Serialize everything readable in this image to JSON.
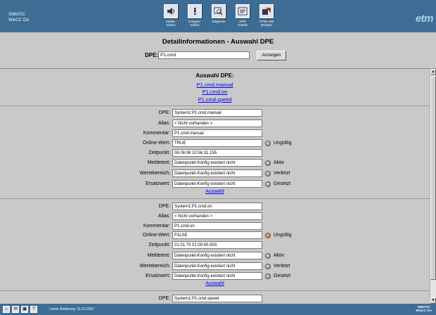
{
  "brand": {
    "line1": "SIMATIC",
    "line2": "WinCC OA"
  },
  "nav": [
    {
      "icon": "speaker-icon",
      "line1": "Melde-",
      "line2": "schirm"
    },
    {
      "icon": "exclamation-icon",
      "line1": "Ereignis-",
      "line2": "schirm"
    },
    {
      "icon": "magnifier-icon",
      "line1": "Diagnose",
      "line2": ""
    },
    {
      "icon": "dpe-details-icon",
      "line1": "DPE",
      "line2": "Details"
    },
    {
      "icon": "html-example-icon",
      "line1": "HTML-Ref",
      "line2": "Beispiel"
    }
  ],
  "logo": "etm",
  "header": {
    "title": "Detailinformationen - Auswahl DPE",
    "dpe_label": "DPE:",
    "dpe_value": "P1.cmd",
    "show_button": "Anzeigen"
  },
  "selection": {
    "title": "Auswahl DPE:",
    "links": [
      "P1.cmd.manual",
      "P1.cmd.on",
      "P1.cmd.speed"
    ]
  },
  "labels": {
    "dpe": "DPE:",
    "alias": "Alias:",
    "kommentar": "Kommentar:",
    "online": "Online-Wert:",
    "zeit": "Zeitpunkt:",
    "meldetext": "Meldetext:",
    "wertebereich": "Wertebereich:",
    "ersatzwert": "Ersatzwert:",
    "auswahl": "Auswahl"
  },
  "dpes": [
    {
      "dpe": "System1:P1.cmd.manual",
      "alias": "< Nicht vorhanden >",
      "kommentar": "P1.cmd.manual",
      "online": "TRUE",
      "online_status": "Ungültig",
      "zeit": "06.08.08 10:56:31.155",
      "meldetext": "Datenpunkt-Konfig existiert nicht",
      "meldetext_status": "Aktiv",
      "wertebereich": "Datenpunkt-Konfig existiert nicht",
      "wertebereich_status": "Verletzt",
      "ersatzwert": "Datenpunkt-Konfig existiert nicht",
      "ersatzwert_status": "Gesetzt"
    },
    {
      "dpe": "System1:P1.cmd.on",
      "alias": "< Nicht vorhanden >",
      "kommentar": "P1.cmd.on",
      "online": "FALSE",
      "online_status": "Ungültig",
      "zeit": "01.01.70 01:00:00.000",
      "meldetext": "Datenpunkt-Konfig existiert nicht",
      "meldetext_status": "Aktiv",
      "wertebereich": "Datenpunkt-Konfig existiert nicht",
      "wertebereich_status": "Verletzt",
      "ersatzwert": "Datenpunkt-Konfig existiert nicht",
      "ersatzwert_status": "Gesetzt"
    }
  ],
  "partial_dpe": "System1:P1.cmd.speed",
  "footer": {
    "status": "Letzte Änderung: 11.10.2007",
    "logo_line1": "SIMATIC",
    "logo_line2": "WinCC OA"
  },
  "colors": {
    "topbar": "#3d6c94",
    "status_alarm": "#e05a00",
    "status_grey": "#888888"
  }
}
